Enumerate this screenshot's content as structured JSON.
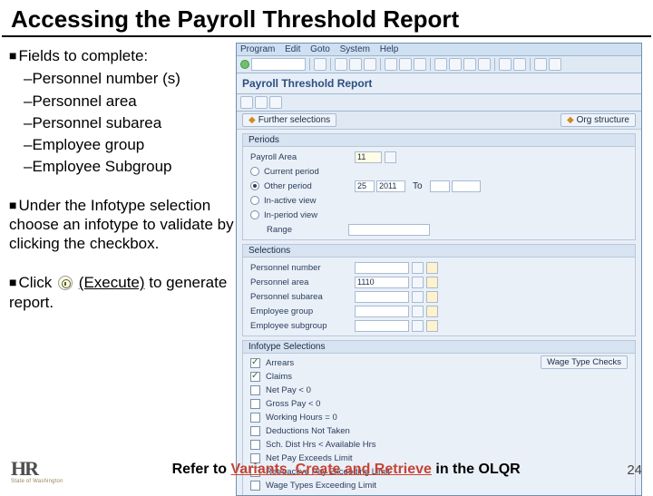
{
  "title": "Accessing the Payroll Threshold Report",
  "left": {
    "bullet1": "Fields to complete:",
    "fields": [
      "Personnel number (s)",
      "Personnel area",
      "Personnel subarea",
      "Employee group",
      "Employee Subgroup"
    ],
    "infotype_para_a": "Under the Infotype selection choose an infotype to validate by clicking the checkbox.",
    "click_label": "Click",
    "execute_label": "(Execute)",
    "click_tail": " to generate report."
  },
  "sap": {
    "menu": [
      "Program",
      "Edit",
      "Goto",
      "System",
      "Help"
    ],
    "report_title": "Payroll Threshold Report",
    "further_selections": "Further selections",
    "org_structure": "Org structure",
    "periods_head": "Periods",
    "payroll_area_label": "Payroll Area",
    "payroll_area_value": "11",
    "radio_current": "Current period",
    "radio_other": "Other period",
    "other_period_val1": "25",
    "other_period_val2": "2011",
    "other_period_to": "To",
    "radio_in_active": "In-active view",
    "radio_in_period": "In-period view",
    "range_label": "Range",
    "selections_head": "Selections",
    "sel_rows": [
      {
        "label": "Personnel number",
        "val": "",
        "btns": 2
      },
      {
        "label": "Personnel area",
        "val": "1110",
        "btns": 2
      },
      {
        "label": "Personnel subarea",
        "val": "",
        "btns": 2
      },
      {
        "label": "Employee group",
        "val": "",
        "btns": 2
      },
      {
        "label": "Employee subgroup",
        "val": "",
        "btns": 2
      }
    ],
    "infotype_head": "Infotype Selections",
    "wage_btn": "Wage Type Checks",
    "infotypes": [
      {
        "checked": true,
        "label": "Arrears"
      },
      {
        "checked": true,
        "label": "Claims"
      },
      {
        "checked": false,
        "label": "Net Pay < 0"
      },
      {
        "checked": false,
        "label": "Gross Pay < 0"
      },
      {
        "checked": false,
        "label": "Working Hours = 0"
      },
      {
        "checked": false,
        "label": "Deductions Not Taken"
      },
      {
        "checked": false,
        "label": "Sch. Dist Hrs < Available Hrs"
      },
      {
        "checked": false,
        "label": "Net Pay Exceeds Limit"
      },
      {
        "checked": false,
        "label": "Retroactive Pay Exceeding Limit"
      },
      {
        "checked": false,
        "label": "Wage Types Exceeding Limit"
      }
    ]
  },
  "footer": {
    "refer_pre": "Refer to ",
    "refer_link": "Variants_Create and Retrieve",
    "refer_post": " in the OLQR",
    "page": "24",
    "sow": "State of Washington"
  }
}
